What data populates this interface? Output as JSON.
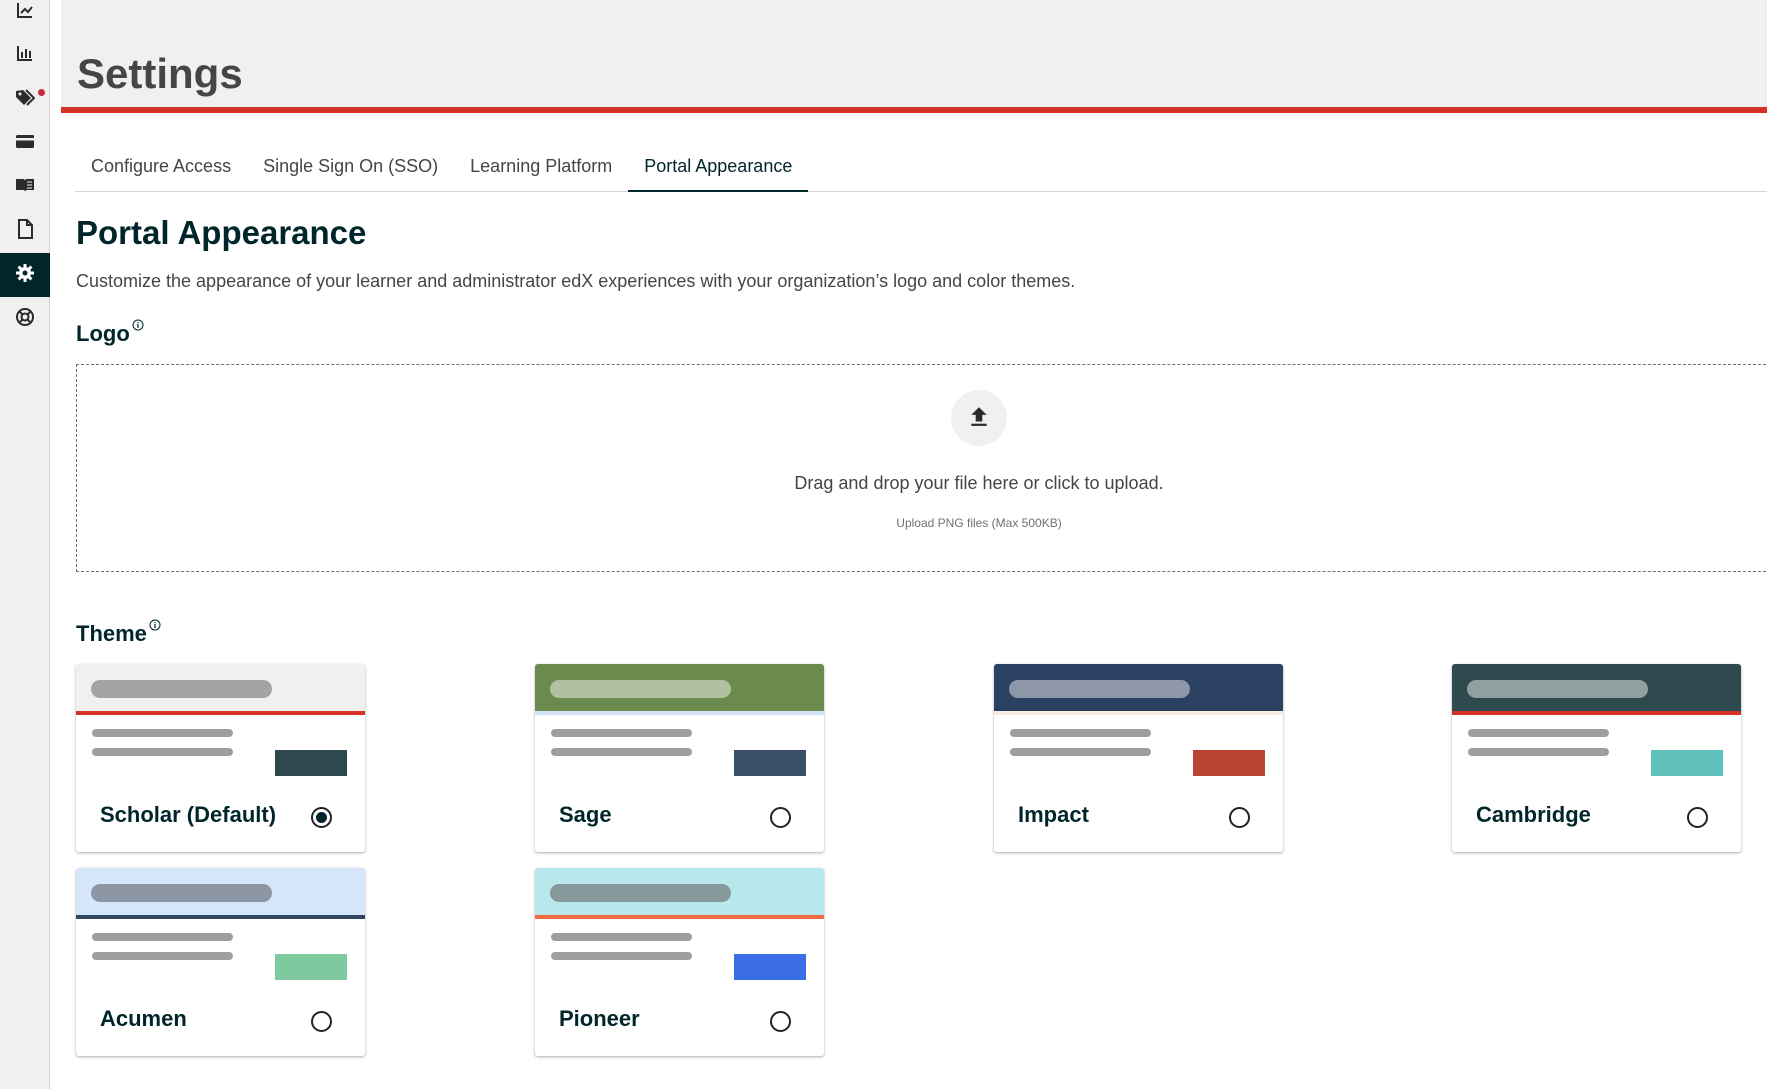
{
  "sidebar": {
    "items": [
      {
        "icon": "trending-chart-icon",
        "active": false
      },
      {
        "icon": "bar-chart-icon",
        "active": false
      },
      {
        "icon": "tags-icon",
        "active": false,
        "notification": true
      },
      {
        "icon": "credit-card-icon",
        "active": false
      },
      {
        "icon": "book-icon",
        "active": false
      },
      {
        "icon": "document-icon",
        "active": false
      },
      {
        "icon": "gear-icon",
        "active": true
      },
      {
        "icon": "support-icon",
        "active": false
      }
    ]
  },
  "header": {
    "title": "Settings",
    "accent_color": "#d23228"
  },
  "tabs": [
    {
      "label": "Configure Access",
      "active": false
    },
    {
      "label": "Single Sign On (SSO)",
      "active": false
    },
    {
      "label": "Learning Platform",
      "active": false
    },
    {
      "label": "Portal Appearance",
      "active": true
    }
  ],
  "section": {
    "title": "Portal Appearance",
    "description": "Customize the appearance of your learner and administrator edX experiences with your organization’s logo and color themes."
  },
  "logo": {
    "label": "Logo",
    "upload_text": "Drag and drop your file here or click to upload.",
    "upload_hint": "Upload PNG files (Max 500KB)",
    "upload_icon": "upload-icon"
  },
  "theme": {
    "label": "Theme",
    "options": [
      {
        "name": "Scholar (Default)",
        "selected": true,
        "banner": "#f2f0ef",
        "pill": "#a3a3a3",
        "accent": "#d23228",
        "swatch": "#2d494e"
      },
      {
        "name": "Sage",
        "selected": false,
        "banner": "#6a8a4e",
        "pill": "#b1c19f",
        "accent": "#d3e4f5",
        "swatch": "#3b5068"
      },
      {
        "name": "Impact",
        "selected": false,
        "banner": "#2b4162",
        "pill": "#8d97a8",
        "accent": "#f5ede2",
        "swatch": "#b94434"
      },
      {
        "name": "Cambridge",
        "selected": false,
        "banner": "#2e4a4e",
        "pill": "#929fa1",
        "accent": "#d23228",
        "swatch": "#60c1bd"
      },
      {
        "name": "Acumen",
        "selected": false,
        "banner": "#d5e6fb",
        "pill": "#8d96a4",
        "accent": "#33455c",
        "swatch": "#7ec99e"
      },
      {
        "name": "Pioneer",
        "selected": false,
        "banner": "#b8e8ec",
        "pill": "#86999a",
        "accent": "#f26c43",
        "swatch": "#3b6de6"
      }
    ]
  }
}
